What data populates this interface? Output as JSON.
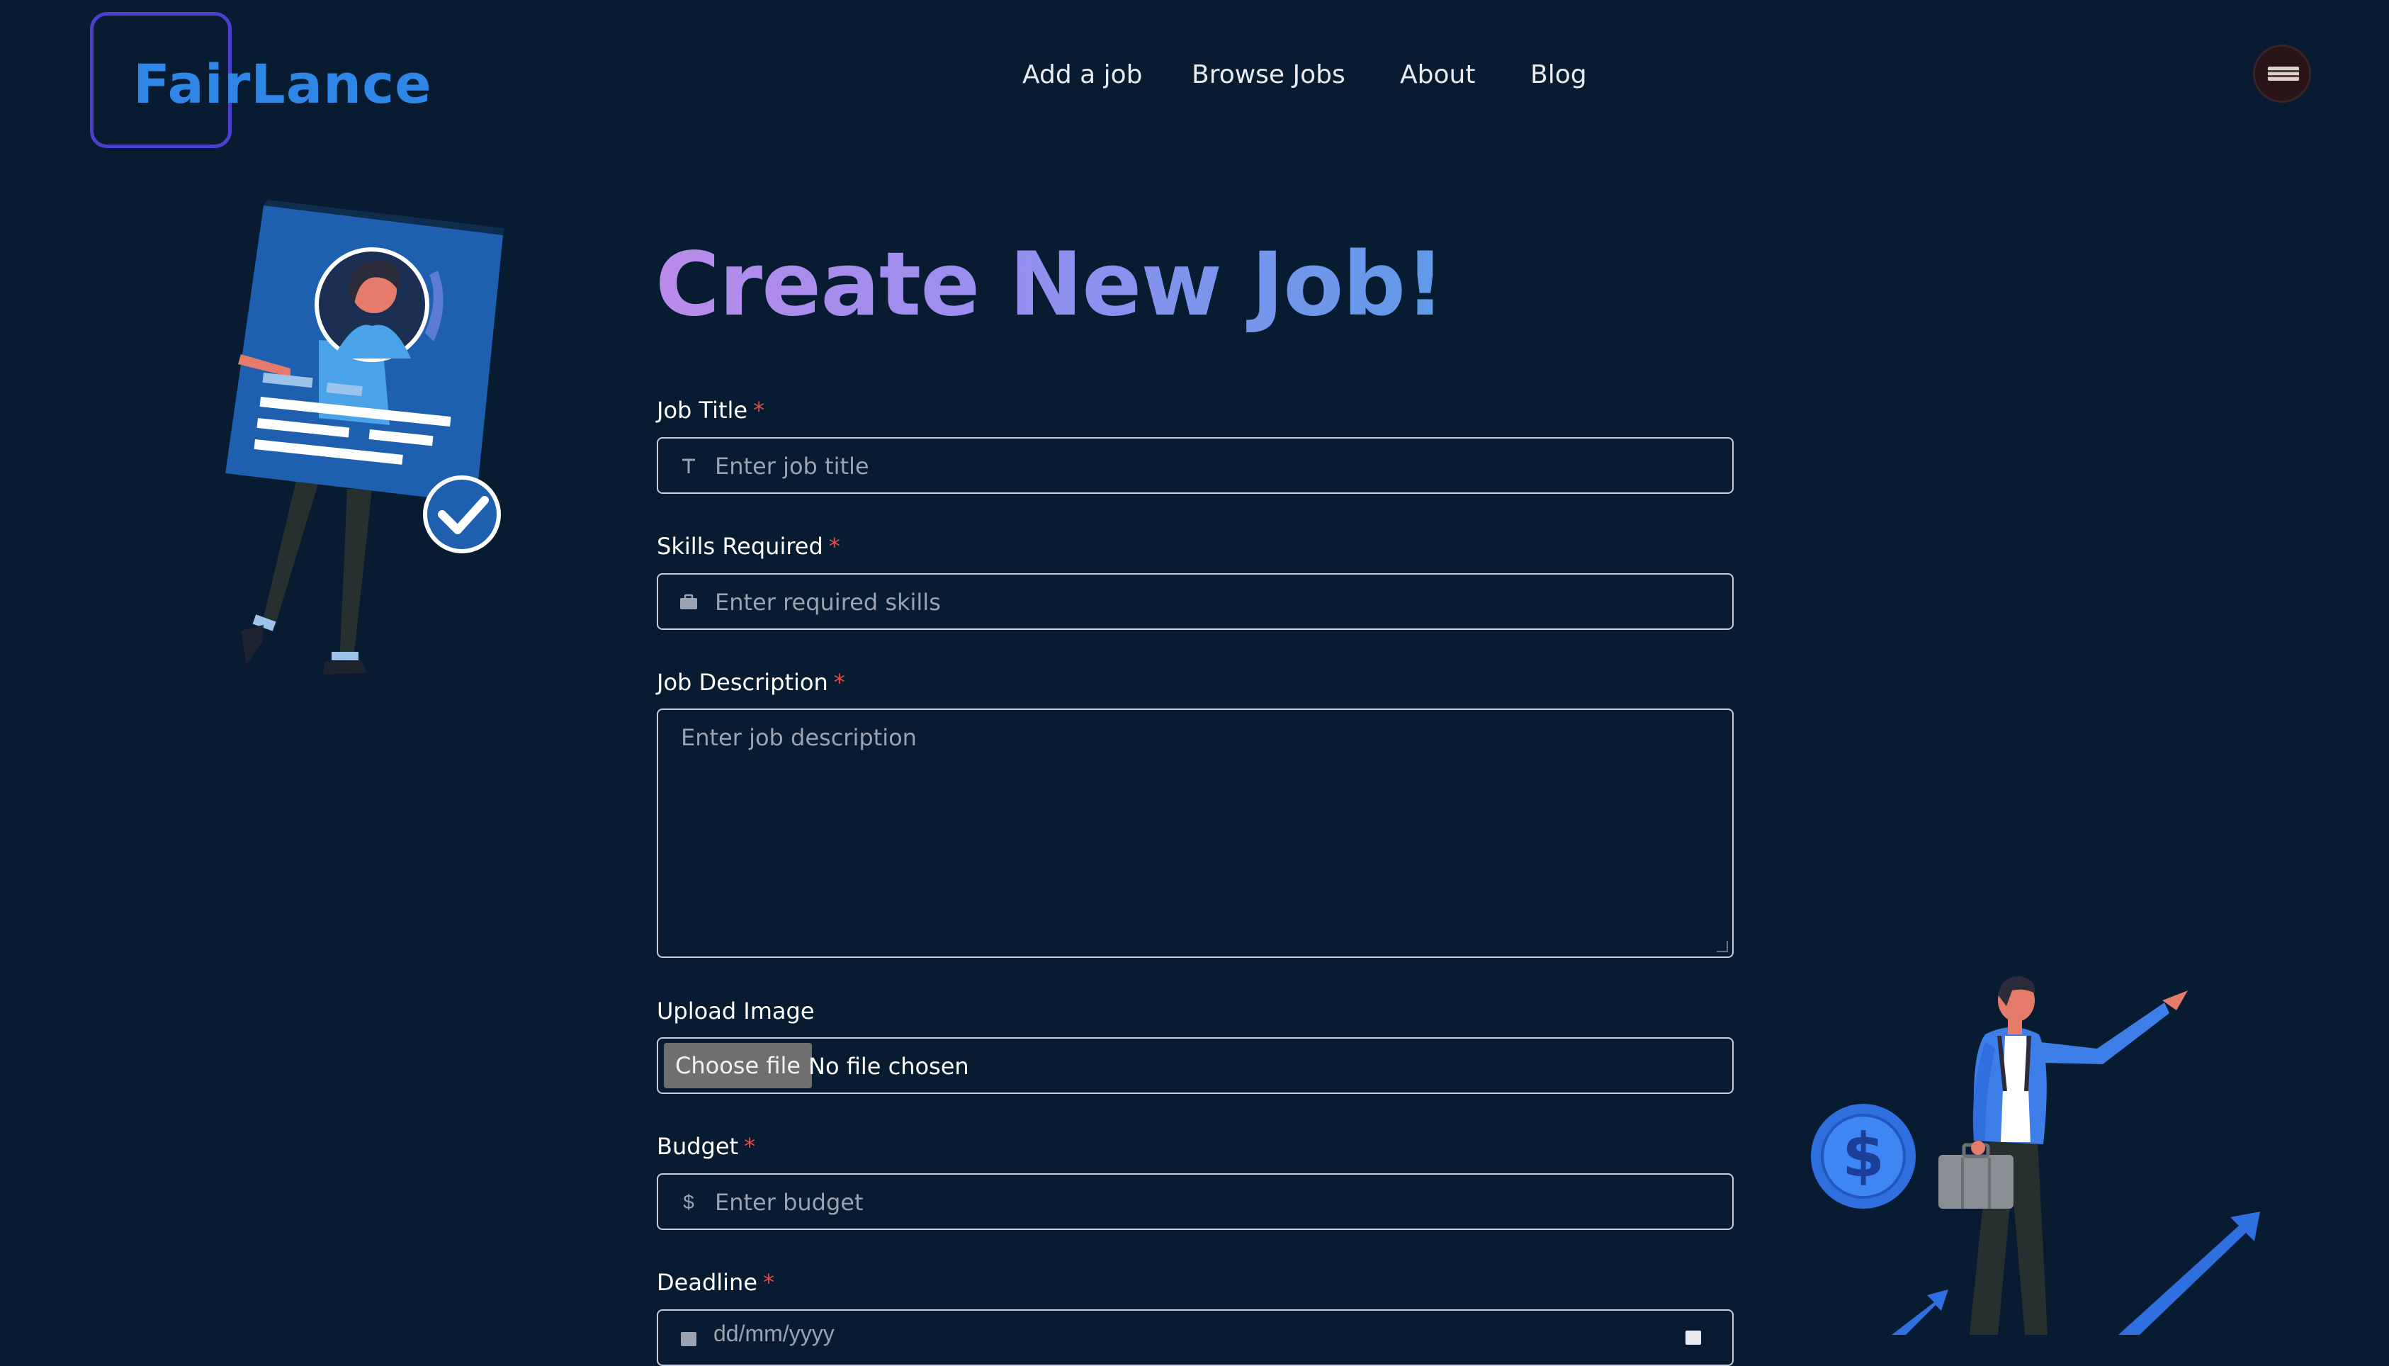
{
  "brand": {
    "name": "FairLance"
  },
  "nav": {
    "items": [
      "Add a job",
      "Browse Jobs",
      "About",
      "Blog"
    ]
  },
  "page": {
    "title": "Create New Job!"
  },
  "form": {
    "job_title": {
      "label": "Job Title",
      "required": "*",
      "placeholder": "Enter job title",
      "icon": "text-icon"
    },
    "skills": {
      "label": "Skills Required",
      "required": "*",
      "placeholder": "Enter required skills",
      "icon": "briefcase-icon"
    },
    "description": {
      "label": "Job Description",
      "required": "*",
      "placeholder": "Enter job description"
    },
    "image": {
      "label": "Upload Image",
      "button": "Choose file",
      "status": "No file chosen"
    },
    "budget": {
      "label": "Budget",
      "required": "*",
      "placeholder": "Enter budget",
      "icon_glyph": "$",
      "icon": "dollar-icon"
    },
    "deadline": {
      "label": "Deadline",
      "required": "*",
      "value": "dd/mm/yyyy",
      "icon": "calendar-icon"
    }
  },
  "colors": {
    "background": "#071c31",
    "brand": "#2f86e6",
    "logo_border": "#4a3fd0",
    "required": "#e14b4b"
  }
}
